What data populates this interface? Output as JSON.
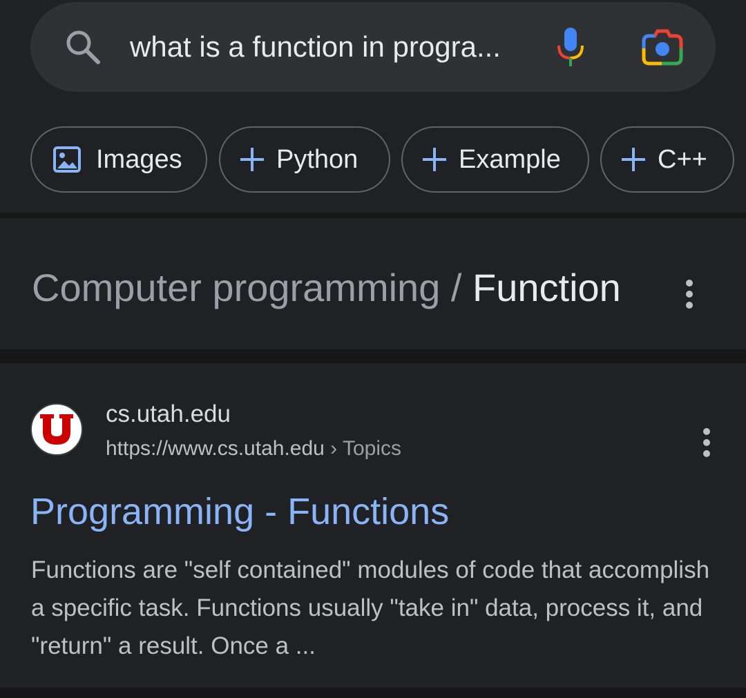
{
  "search": {
    "query": "what is a function in progra..."
  },
  "chips": [
    {
      "label": "Images",
      "icon": "image-icon"
    },
    {
      "label": "Python",
      "icon": "plus-icon"
    },
    {
      "label": "Example",
      "icon": "plus-icon"
    },
    {
      "label": "C++",
      "icon": "plus-icon"
    }
  ],
  "breadcrumb": {
    "parent": "Computer programming",
    "separator": " / ",
    "current": "Function"
  },
  "result": {
    "site_name": "cs.utah.edu",
    "url": "https://www.cs.utah.edu",
    "url_separator": " › ",
    "url_path": "Topics",
    "title": "Programming - Functions",
    "snippet": "Functions are \"self contained\" modules of code that accomplish a specific task. Functions usually \"take in\" data, process it, and \"return\" a result. Once a ..."
  },
  "colors": {
    "background": "#202124",
    "link": "#8ab4f8",
    "text": "#e8eaed",
    "muted": "#9aa0a6",
    "favicon_red": "#cc0000"
  }
}
